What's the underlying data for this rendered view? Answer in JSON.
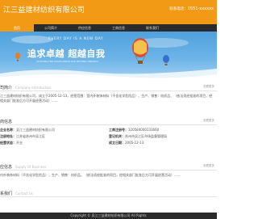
{
  "header": {
    "company_name": "江三益建材纺织有限公司",
    "hotline_label": "联系电话：",
    "hotline_number": "0551-xxxxxx"
  },
  "nav": {
    "items": [
      {
        "label": "首页"
      },
      {
        "label": "公司简介"
      },
      {
        "label": "供应信息"
      },
      {
        "label": "工商信息"
      },
      {
        "label": "联系我们"
      }
    ]
  },
  "banner": {
    "sub": "EVERY DAY IS A NEW DAY",
    "slogan": "追求卓越  超越自我",
    "tiny": "STRIVING FOR EXCELLENCE AND BEYOND ONESELF"
  },
  "about": {
    "title": "司简介",
    "en": "Company Introduction",
    "more": "查看更多",
    "text": "江三益建材纺织有限公司，成立于2005-12-13，经营范围：室内外装饰材料（不含化学危险品）、生产、销售：纺织品、（依法须经批准的项目，经相关部门批准后方可开展经营活动）......"
  },
  "business": {
    "title": "商信息",
    "more": "查看更多",
    "company_name_label": "企业名称：",
    "company_name": "吴江三益建材纺织有限公司",
    "reg_no_label": "工商注册号：",
    "reg_no": "320584000133660",
    "address_label": "注册地址：",
    "address": "江苏省苏州市吴江区",
    "org_label": "登记机关：",
    "org": "苏州市吴江区市场监督管理局",
    "status_label": "经营状态：",
    "status": "开业",
    "date_label": "成立日期：",
    "date": "2005-12-13"
  },
  "supply": {
    "title": "应信息",
    "en": "Supply Of Business",
    "more": "查看更多",
    "text": "内外装饰材料（不含化学危险品）；生产、销售：纺织品。（依法须经批准的项目，经相关部门批准后方可开展经营活动）......"
  },
  "contact": {
    "title": "系我们",
    "en": "Contact Us"
  },
  "footer": {
    "text": "Copyright © 吴江三益建材纺织有限公司 All Rights"
  }
}
